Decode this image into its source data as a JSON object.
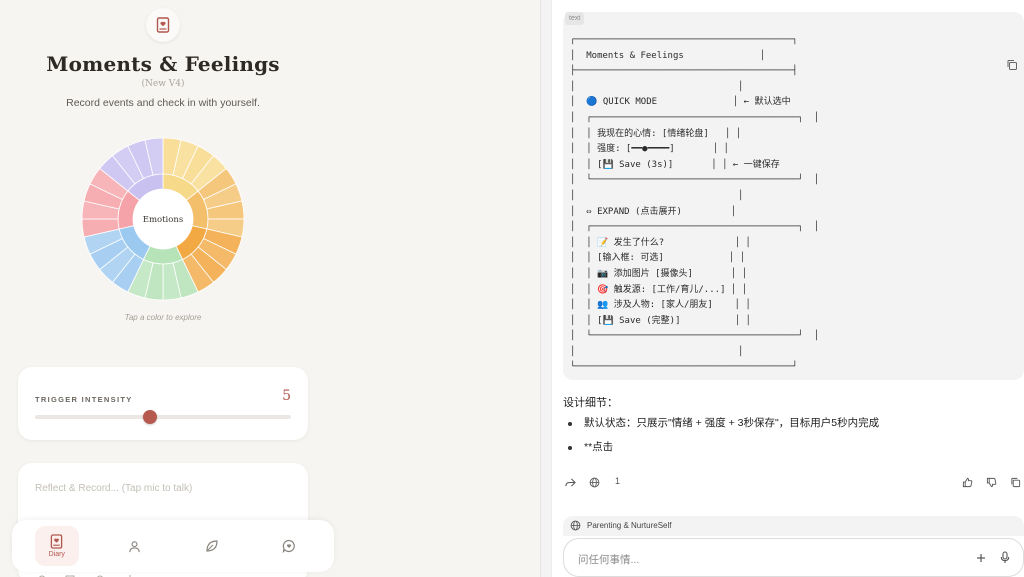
{
  "app": {
    "title": "Moments & Feelings",
    "version": "(New V4)",
    "subtitle": "Record events and check in with yourself.",
    "wheel_center_label": "Emotions",
    "wheel_hint": "Tap a color to explore"
  },
  "wheel": {
    "segments": [
      {
        "color": "#f7d98a"
      },
      {
        "color": "#f4bf6b"
      },
      {
        "color": "#f3a943"
      },
      {
        "color": "#b7e3b9"
      },
      {
        "color": "#9cc9ef"
      },
      {
        "color": "#f5a3a8"
      },
      {
        "color": "#c9c1f0"
      }
    ]
  },
  "intensity": {
    "label": "TRIGGER INTENSITY",
    "value_text": "5",
    "value_fraction": 0.45
  },
  "reflect": {
    "placeholder": "Reflect & Record... (Tap mic to talk)"
  },
  "bottom_nav": {
    "items": [
      {
        "label": "Diary",
        "icon": "book-heart-icon",
        "active": true
      },
      {
        "label": "",
        "icon": "person-icon",
        "active": false
      },
      {
        "label": "",
        "icon": "leaf-icon",
        "active": false
      },
      {
        "label": "",
        "icon": "heart-chat-icon",
        "active": false
      }
    ]
  },
  "chat": {
    "code_lang": "text",
    "code": "┌────────────────────────────────────────┐\n│  Moments & Feelings              │\n├────────────────────────────────────────┤\n│                              │\n│  🔵 QUICK MODE              │ ← 默认选中\n│  ┌──────────────────────────────────────┐  │\n│  │ 我现在的心情: [情绪轮盘]   │ │\n│  │ 强度: [━━●━━━━]       │ │\n│  │ [💾 Save (3s)]       │ │ ← 一键保存\n│  └──────────────────────────────────────┘  │\n│                              │\n│  ⇔ EXPAND (点击展开)         │\n│  ┌──────────────────────────────────────┐  │\n│  │ 📝 发生了什么?             │ │\n│  │ [输入框: 可选]            │ │\n│  │ 📷 添加图片 [摄像头]       │ │\n│  │ 🎯 触发源: [工作/育儿/...] │ │\n│  │ 👥 涉及人物: [家人/朋友]    │ │\n│  │ [💾 Save (完整)]          │ │\n│  └──────────────────────────────────────┘  │\n│                              │\n└────────────────────────────────────────┘",
    "notes_title": "设计细节：",
    "bullets": [
      "默认状态：只展示\"情绪 + 强度 + 3秒保存\"，目标用户5秒内完成",
      "**点击"
    ],
    "sources_count": "1",
    "context_label": "Parenting & NurtureSelf",
    "input_placeholder": "问任何事情..."
  }
}
